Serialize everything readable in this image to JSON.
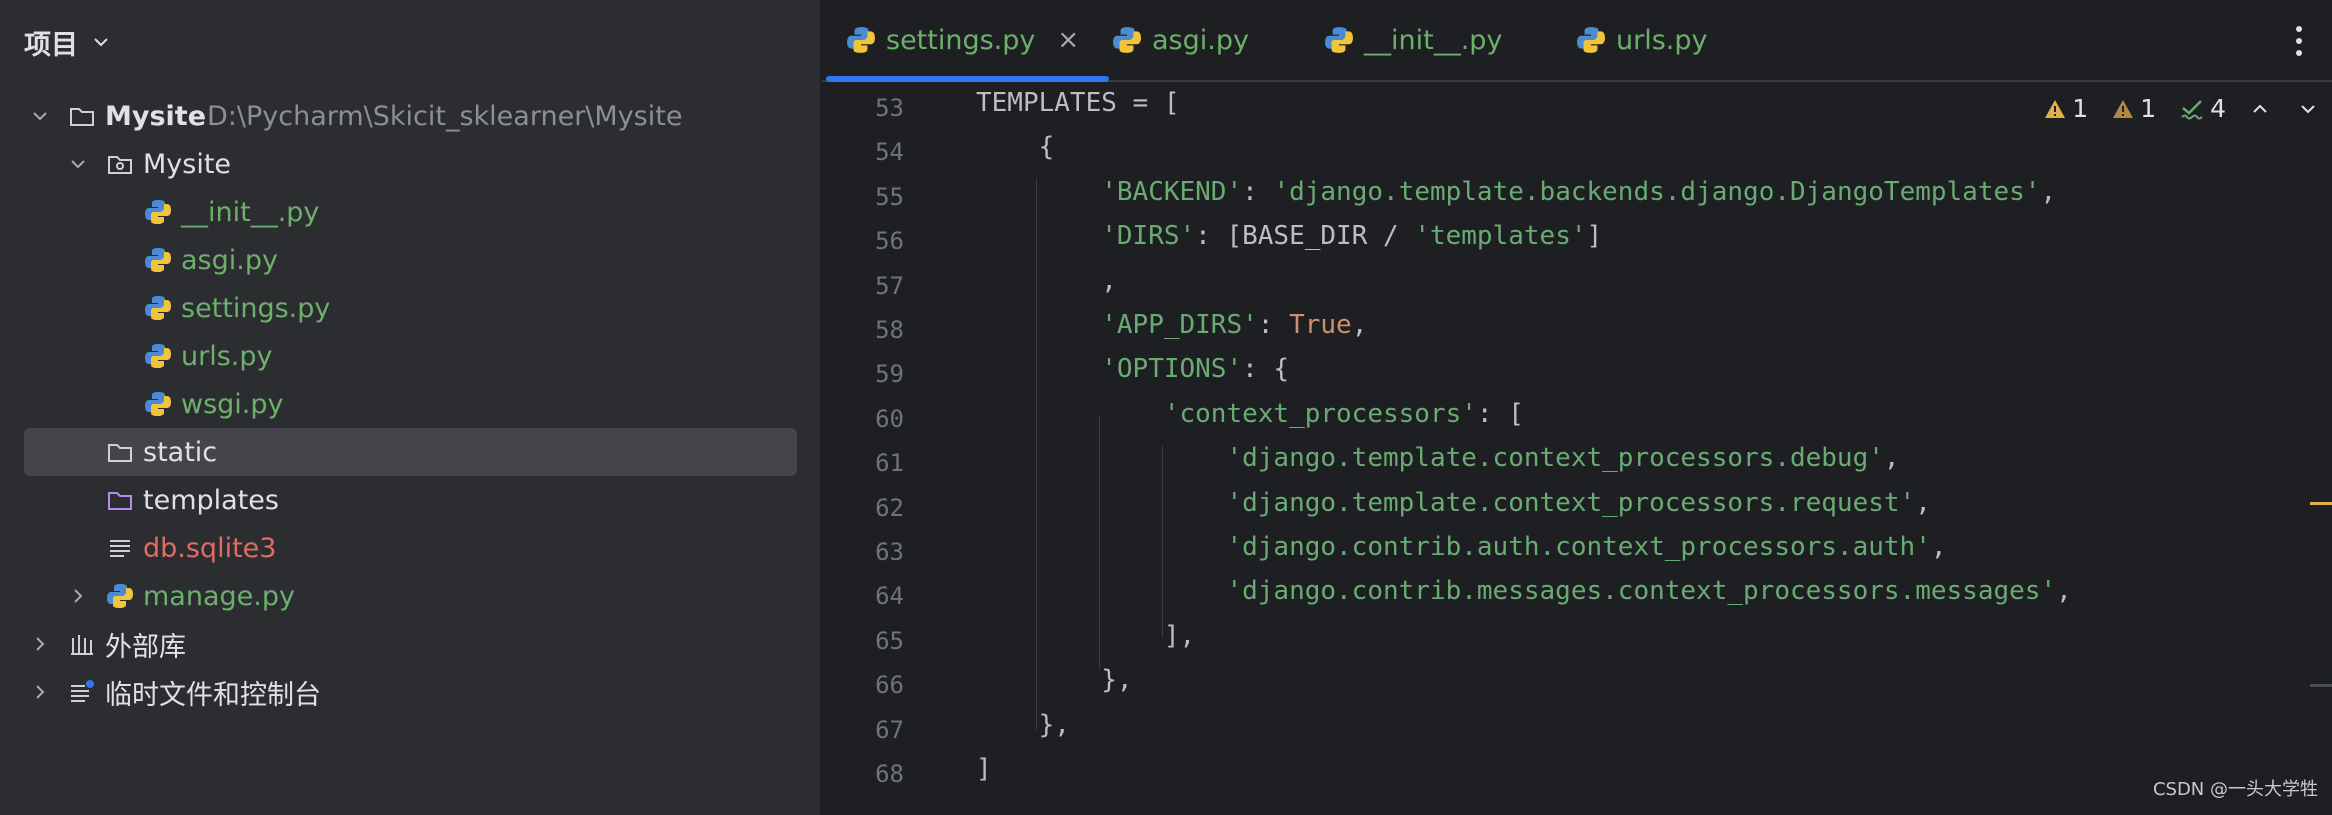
{
  "project": {
    "title": "项目",
    "tree": [
      {
        "label": "Mysite",
        "path": "D:\\Pycharm\\Skicit_sklearner\\Mysite",
        "type": "root"
      },
      {
        "label": "Mysite",
        "type": "package"
      },
      {
        "label": "__init__.py",
        "type": "py"
      },
      {
        "label": "asgi.py",
        "type": "py"
      },
      {
        "label": "settings.py",
        "type": "py"
      },
      {
        "label": "urls.py",
        "type": "py"
      },
      {
        "label": "wsgi.py",
        "type": "py"
      },
      {
        "label": "static",
        "type": "folder",
        "selected": true
      },
      {
        "label": "templates",
        "type": "folder-templates"
      },
      {
        "label": "db.sqlite3",
        "type": "db"
      },
      {
        "label": "manage.py",
        "type": "py"
      },
      {
        "label": "外部库",
        "type": "libs"
      },
      {
        "label": "临时文件和控制台",
        "type": "scratches"
      }
    ]
  },
  "tabs": [
    {
      "label": "settings.py",
      "active": true,
      "close": "×"
    },
    {
      "label": "asgi.py"
    },
    {
      "label": "__init__.py"
    },
    {
      "label": "urls.py"
    }
  ],
  "inspections": {
    "warnings_a": "1",
    "warnings_b": "1",
    "checks": "4"
  },
  "code": {
    "lines": [
      {
        "n": "53",
        "t": "TEMPLATES = ["
      },
      {
        "n": "54",
        "t": "    {"
      },
      {
        "n": "55",
        "t": "        'BACKEND': 'django.template.backends.django.DjangoTemplates',"
      },
      {
        "n": "56",
        "t": "        'DIRS': [BASE_DIR / 'templates']"
      },
      {
        "n": "57",
        "t": "        ,"
      },
      {
        "n": "58",
        "t": "        'APP_DIRS': True,"
      },
      {
        "n": "59",
        "t": "        'OPTIONS': {"
      },
      {
        "n": "60",
        "t": "            'context_processors': ["
      },
      {
        "n": "61",
        "t": "                'django.template.context_processors.debug',"
      },
      {
        "n": "62",
        "t": "                'django.template.context_processors.request',"
      },
      {
        "n": "63",
        "t": "                'django.contrib.auth.context_processors.auth',"
      },
      {
        "n": "64",
        "t": "                'django.contrib.messages.context_processors.messages',"
      },
      {
        "n": "65",
        "t": "            ],"
      },
      {
        "n": "66",
        "t": "        },"
      },
      {
        "n": "67",
        "t": "    },"
      },
      {
        "n": "68",
        "t": "]"
      }
    ]
  },
  "watermark": "CSDN @一头大学牲",
  "colors": {
    "accent": "#3574f0",
    "string": "#6aab73",
    "keyword": "#cf8e6d",
    "vcs_new": "#6cb06b",
    "vcs_unversioned": "#e06c63"
  }
}
